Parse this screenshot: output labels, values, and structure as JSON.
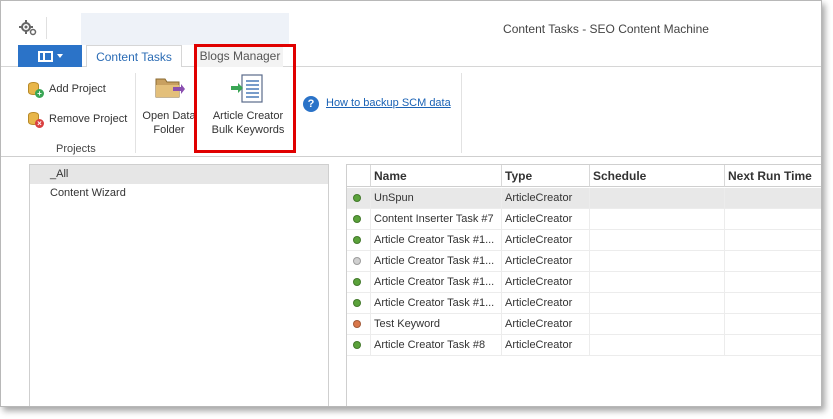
{
  "window": {
    "title": "Content Tasks - SEO Content Machine"
  },
  "tabs": [
    {
      "label": "Content Tasks",
      "active": true
    },
    {
      "label": "Blogs Manager",
      "active": false
    }
  ],
  "ribbon": {
    "projects_group": {
      "label": "Projects",
      "add_label": "Add Project",
      "remove_label": "Remove Project"
    },
    "open_data_folder": {
      "line1": "Open Data",
      "line2": "Folder"
    },
    "article_bulk": {
      "line1": "Article Creator",
      "line2": "Bulk Keywords"
    },
    "backup_link": "How to backup SCM data"
  },
  "tree": {
    "items": [
      {
        "label": "_All",
        "selected": true
      },
      {
        "label": "Content Wizard",
        "selected": false
      }
    ]
  },
  "grid": {
    "columns": [
      "Name",
      "Type",
      "Schedule",
      "Next Run Time"
    ],
    "rows": [
      {
        "name": "UnSpun",
        "type": "ArticleCreator",
        "schedule": "",
        "next_run": "",
        "status_color": "#5aa23a",
        "selected": true
      },
      {
        "name": "Content Inserter Task #7",
        "type": "ArticleCreator",
        "schedule": "",
        "next_run": "",
        "status_color": "#5aa23a",
        "selected": false
      },
      {
        "name": "Article Creator Task #1...",
        "type": "ArticleCreator",
        "schedule": "",
        "next_run": "",
        "status_color": "#5aa23a",
        "selected": false
      },
      {
        "name": "Article Creator Task #1...",
        "type": "ArticleCreator",
        "schedule": "",
        "next_run": "",
        "status_color": "#d0d0d0",
        "selected": false
      },
      {
        "name": "Article Creator Task #1...",
        "type": "ArticleCreator",
        "schedule": "",
        "next_run": "",
        "status_color": "#5aa23a",
        "selected": false
      },
      {
        "name": "Article Creator Task #1...",
        "type": "ArticleCreator",
        "schedule": "",
        "next_run": "",
        "status_color": "#5aa23a",
        "selected": false
      },
      {
        "name": "Test Keyword",
        "type": "ArticleCreator",
        "schedule": "",
        "next_run": "",
        "status_color": "#d9774a",
        "selected": false
      },
      {
        "name": "Article Creator Task #8",
        "type": "ArticleCreator",
        "schedule": "",
        "next_run": "",
        "status_color": "#5aa23a",
        "selected": false
      }
    ]
  },
  "colors": {
    "accent": "#2b73c8",
    "link": "#1a62b5",
    "highlight": "#e00000"
  },
  "icons": [
    "gear-icon",
    "file-menu-icon",
    "add-project-icon",
    "remove-project-icon",
    "folder-icon",
    "bulk-keywords-icon",
    "help-icon"
  ]
}
